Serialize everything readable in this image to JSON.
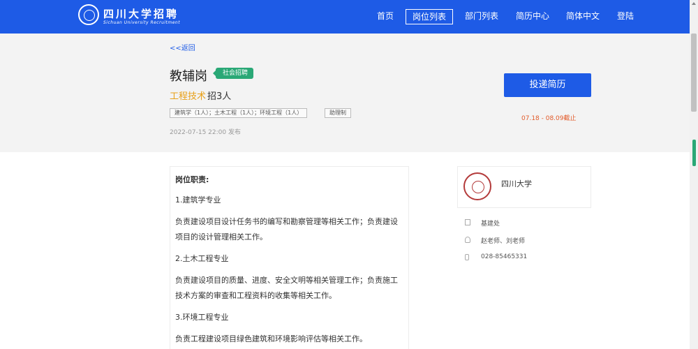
{
  "header": {
    "brand_cn": "四川大学招聘",
    "brand_en": "Sichuan University Recruitment",
    "nav": [
      "首页",
      "岗位列表",
      "部门列表",
      "简历中心",
      "简体中文",
      "登陆"
    ]
  },
  "job": {
    "back": "<<返回",
    "title": "教辅岗",
    "badge": "社会招聘",
    "category": "工程技术",
    "headcount": "招3人",
    "tags": [
      "建筑学（1人）；土木工程（1人）；环境工程（1人）",
      "助理制"
    ],
    "posted": "2022-07-15 22:00 发布",
    "apply_label": "投递简历",
    "deadline": "07.18 - 08.09截止"
  },
  "description": {
    "heading": "岗位职责:",
    "lines": [
      "1.建筑学专业",
      "负责建设项目设计任务书的编写和勘察管理等相关工作；负责建设",
      "项目的设计管理相关工作。",
      "2.土木工程专业",
      "负责建设项目的质量、进度、安全文明等相关管理工作；负责施工",
      "技术方案的审查和工程资料的收集等相关工作。",
      "3.环境工程专业",
      "负责工程建设项目绿色建筑和环境影响评估等相关工作。"
    ]
  },
  "employer": {
    "name": "四川大学",
    "department": "基建处",
    "contacts": "赵老师、刘老师",
    "phone": "028-85465331"
  },
  "icons": {
    "building": "building-icon",
    "person": "person-icon",
    "phone": "phone-icon"
  },
  "colors": {
    "primary": "#1e5be6",
    "badge": "#2aa876",
    "category": "#e8a019",
    "deadline": "#e25b2a"
  }
}
